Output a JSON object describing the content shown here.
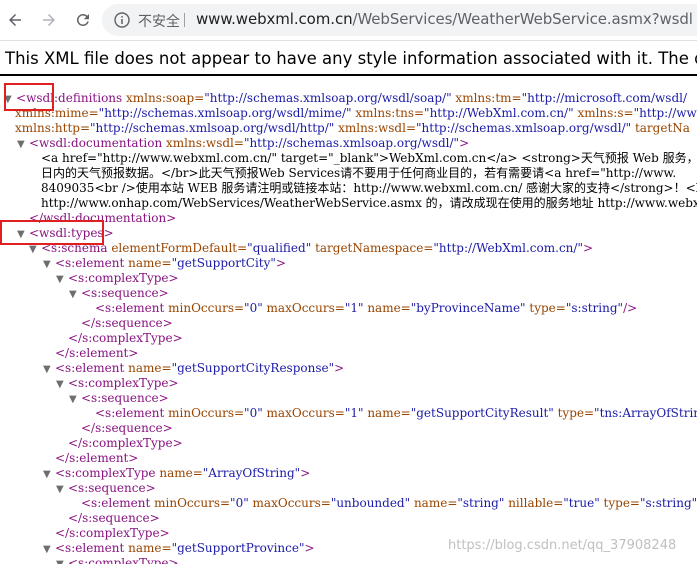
{
  "browser": {
    "security_label": "不安全",
    "url_host": "www.webxml.com.cn",
    "url_path": "/WebServices/WeatherWebService.asmx?wsdl"
  },
  "notice": "This XML file does not appear to have any style information associated with it. The document tree is shown below.",
  "xml": {
    "l1a": "wsdl",
    "l1b": ":definitions",
    "l1c": " xmlns:soap=",
    "l1d": "\"http://schemas.xmlsoap.org/wsdl/soap/\"",
    "l1e": " xmlns:tm=",
    "l1f": "\"http://microsoft.com/wsdl/",
    "l2a": "xmlns:mime=",
    "l2b": "\"http://schemas.xmlsoap.org/wsdl/mime/\"",
    "l2c": " xmlns:tns=",
    "l2d": "\"http://WebXml.com.cn/\"",
    "l2e": " xmlns:s=",
    "l2f": "\"http://www.",
    "l3a": "xmlns:http=",
    "l3b": "\"http://schemas.xmlsoap.org/wsdl/http/\"",
    "l3c": " xmlns:wsdl=",
    "l3d": "\"http://schemas.xmlsoap.org/wsdl/\"",
    "l3e": " targetNa",
    "l4a": "<wsdl:documentation",
    "l4b": " xmlns:wsdl=",
    "l4c": "\"http://schemas.xmlsoap.org/wsdl/\"",
    "l4d": ">",
    "l5": "<a href=\"http://www.webxml.com.cn/\" target=\"_blank\">WebXml.com.cn</a> <strong>天气预报 Web 服务，数据",
    "l6": "日内的天气预报数据。</br>此天气预报Web Services请不要用于任何商业目的，若有需要请<a href=\"http://www.",
    "l7": "8409035<br />使用本站 WEB 服务请注明或链接本站：http://www.webxml.com.cn/ 感谢大家的支持</strong>！<b",
    "l8": "http://www.onhap.com/WebServices/WeatherWebService.asmx 的，请改成现在使用的服务地址 http://www.webxm",
    "l9": "</wsdl:documentation>",
    "l10": "<wsdl:types>",
    "l11a": "<s:schema",
    "l11b": " elementFormDefault=",
    "l11c": "\"qualified\"",
    "l11d": " targetNamespace=",
    "l11e": "\"http://WebXml.com.cn/\"",
    "l11f": ">",
    "l12a": "<s:element",
    "l12b": " name=",
    "l12c": "\"getSupportCity\"",
    "l12d": ">",
    "l13": "<s:complexType>",
    "l14": "<s:sequence>",
    "l15a": "<s:element",
    "l15b": " minOccurs=",
    "l15c": "\"0\"",
    "l15d": " maxOccurs=",
    "l15e": "\"1\"",
    "l15f": " name=",
    "l15g": "\"byProvinceName\"",
    "l15h": " type=",
    "l15i": "\"s:string\"",
    "l15j": "/>",
    "l16": "</s:sequence>",
    "l17": "</s:complexType>",
    "l18": "</s:element>",
    "l19a": "<s:element",
    "l19b": " name=",
    "l19c": "\"getSupportCityResponse\"",
    "l19d": ">",
    "l20": "<s:complexType>",
    "l21": "<s:sequence>",
    "l22a": "<s:element",
    "l22b": " minOccurs=",
    "l22c": "\"0\"",
    "l22d": " maxOccurs=",
    "l22e": "\"1\"",
    "l22f": " name=",
    "l22g": "\"getSupportCityResult\"",
    "l22h": " type=",
    "l22i": "\"tns:ArrayOfString\"",
    "l22j": "/>",
    "l23": "</s:sequence>",
    "l24": "</s:complexType>",
    "l25": "</s:element>",
    "l26a": "<s:complexType",
    "l26b": " name=",
    "l26c": "\"ArrayOfString\"",
    "l26d": ">",
    "l27": "<s:sequence>",
    "l28a": "<s:element",
    "l28b": " minOccurs=",
    "l28c": "\"0\"",
    "l28d": " maxOccurs=",
    "l28e": "\"unbounded\"",
    "l28f": " name=",
    "l28g": "\"string\"",
    "l28h": " nillable=",
    "l28i": "\"true\"",
    "l28j": " type=",
    "l28k": "\"s:string\"",
    "l28l": "/>",
    "l29": "</s:sequence>",
    "l30": "</s:complexType>",
    "l31a": "<s:element",
    "l31b": " name=",
    "l31c": "\"getSupportProvince\"",
    "l31d": ">",
    "l32": "<s:complexType>"
  },
  "watermark": "https://blog.csdn.net/qq_37908248",
  "colors": {
    "tag": "#881280",
    "attr": "#994500",
    "value": "#1a1aa6",
    "highlight": "#e02020"
  }
}
